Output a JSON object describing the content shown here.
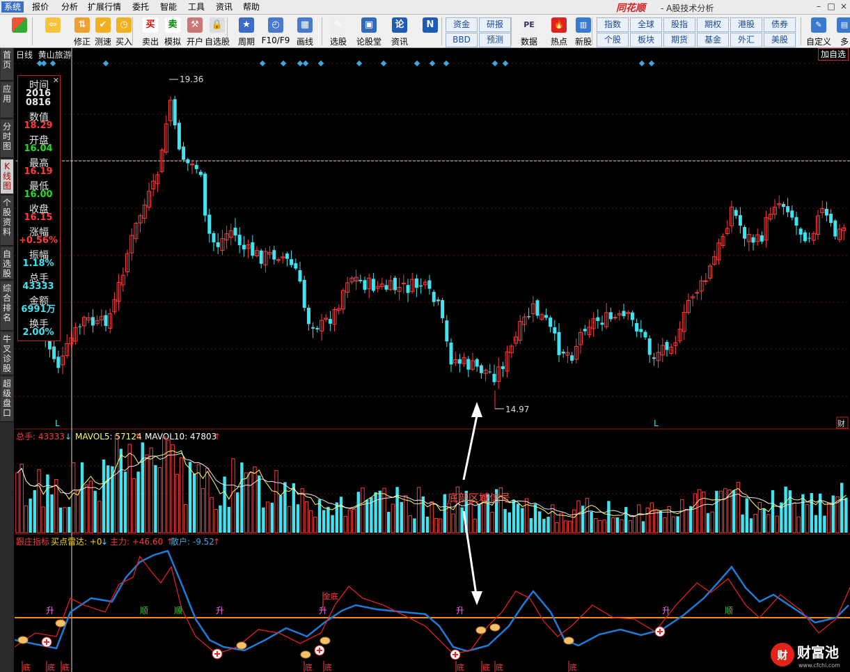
{
  "menubar": {
    "items": [
      "系统",
      "报价",
      "分析",
      "扩展行情",
      "委托",
      "智能",
      "工具",
      "资讯",
      "帮助"
    ],
    "brand": "同花顺",
    "title": "- A股技术分析"
  },
  "toolbar": {
    "buttons": [
      "",
      "",
      "修正",
      "测速",
      "买入",
      "卖出",
      "模拟",
      "开户",
      "自选股",
      "周期",
      "F10/F9",
      "画线",
      "选股",
      "论股堂",
      "资讯",
      "",
      "",
      "数据",
      "热点",
      "新股",
      "自定义",
      "多"
    ],
    "quick": [
      "资金",
      "研报",
      "BBD",
      "预测",
      "指数",
      "全球",
      "股指",
      "期权",
      "港股",
      "债券",
      "个股",
      "板块",
      "期货",
      "基金",
      "外汇",
      "美股"
    ]
  },
  "sidebar": {
    "tabs": [
      "首页",
      "应用",
      "分时图",
      "K线图",
      "个股资料",
      "自选股",
      "综合排名",
      "牛叉诊股",
      "超级盘口"
    ]
  },
  "chart": {
    "period": "日线",
    "stock": "黄山旅游",
    "add_watch": "加自选",
    "high_label": "19.36",
    "low_label": "14.97",
    "marker_l": "L",
    "marker_cai": "财"
  },
  "info_panel": {
    "rows": [
      {
        "label": "时间",
        "value": "2016\n0816",
        "color": "#E6E6E6"
      },
      {
        "label": "数值",
        "value": "18.29",
        "color": "#FF3B3B"
      },
      {
        "label": "开盘",
        "value": "16.04",
        "color": "#22DD22"
      },
      {
        "label": "最高",
        "value": "16.19",
        "color": "#FF3B3B"
      },
      {
        "label": "最低",
        "value": "16.00",
        "color": "#22DD22"
      },
      {
        "label": "收盘",
        "value": "16.15",
        "color": "#FF3B3B"
      },
      {
        "label": "涨幅",
        "value": "+0.56%",
        "color": "#FF3B3B"
      },
      {
        "label": "振幅",
        "value": "1.18%",
        "color": "#3FE4F0"
      },
      {
        "label": "总手",
        "value": "43333",
        "color": "#3FE4F0"
      },
      {
        "label": "金额",
        "value": "6991万",
        "color": "#3FE4F0"
      },
      {
        "label": "换手",
        "value": "2.00%",
        "color": "#3FE4F0"
      }
    ]
  },
  "volume": {
    "total_label": "总手: 43333",
    "mavol5_label": "MAVOL5: 57124",
    "mavol10_label": "MAVOL10: 47803"
  },
  "indicator": {
    "name": "跟庄指标",
    "buy_radar": "买点雷达: +0",
    "main_force": "主力: +46.60",
    "retail": "散户: -9.52",
    "shun_label": "顺",
    "sheng_label": "升",
    "di_label": "底",
    "jindi_label": "金底"
  },
  "annotation": {
    "text": "底部区域信号"
  },
  "watermark": {
    "brand": "财富池",
    "url": "www.cfchi.com"
  },
  "colors": {
    "up": "#FF3B3B",
    "down": "#3FE4F0",
    "ma5": "#FFFF66",
    "ma10": "#FFFFFF",
    "main": "#1E7CD8",
    "retail": "#E02020",
    "hline": "#FF8C1A"
  }
}
